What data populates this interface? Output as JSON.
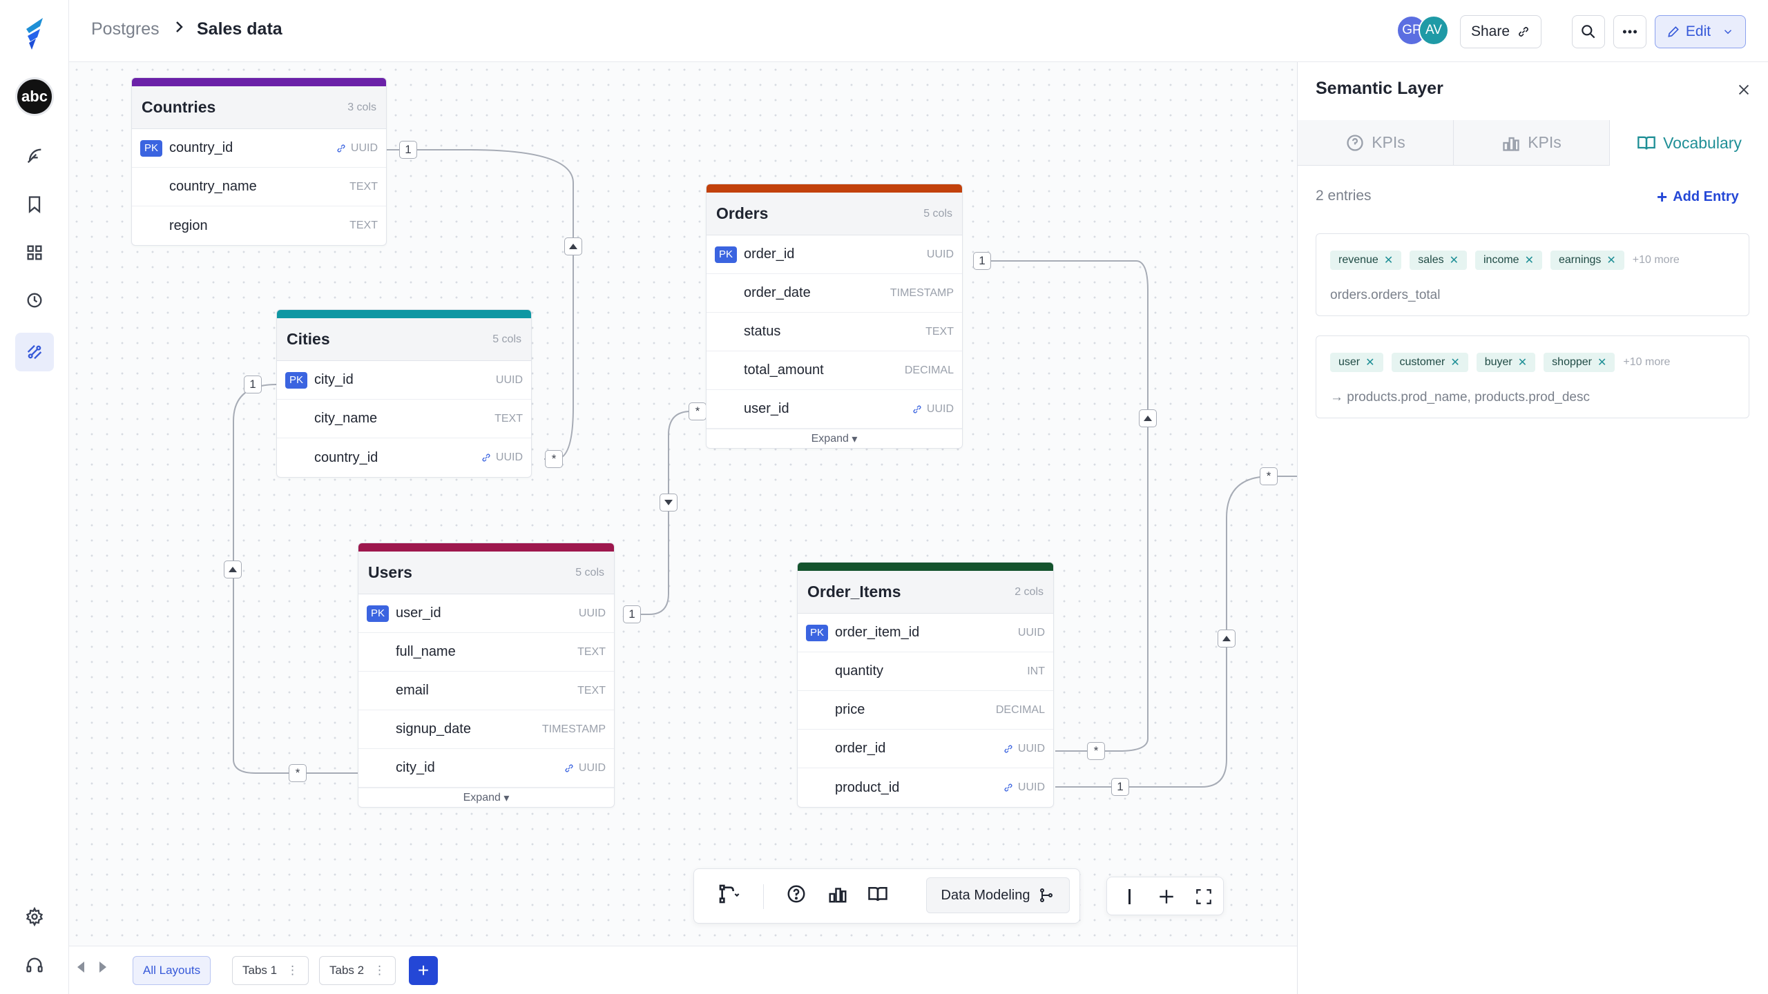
{
  "breadcrumb": {
    "root": "Postgres",
    "current": "Sales data"
  },
  "header": {
    "avatars": [
      "GP",
      "AV"
    ],
    "share_label": "Share",
    "edit_label": "Edit"
  },
  "tables": {
    "countries": {
      "name": "Countries",
      "cols": "3 cols",
      "color": "#6b21a8",
      "rows": [
        {
          "name": "country_id",
          "type": "UUID"
        },
        {
          "name": "country_name",
          "type": "TEXT"
        },
        {
          "name": "region",
          "type": "TEXT"
        }
      ]
    },
    "cities": {
      "name": "Cities",
      "cols": "5 cols",
      "color": "#0f97a3",
      "rows": [
        {
          "name": "city_id",
          "type": "UUID"
        },
        {
          "name": "city_name",
          "type": "TEXT"
        },
        {
          "name": "country_id",
          "type": "UUID"
        }
      ]
    },
    "orders": {
      "name": "Orders",
      "cols": "5 cols",
      "color": "#c2410c",
      "expand": "Expand",
      "rows": [
        {
          "name": "order_id",
          "type": "UUID"
        },
        {
          "name": "order_date",
          "type": "TIMESTAMP"
        },
        {
          "name": "status",
          "type": "TEXT"
        },
        {
          "name": "total_amount",
          "type": "DECIMAL"
        },
        {
          "name": "user_id",
          "type": "UUID"
        }
      ]
    },
    "users": {
      "name": "Users",
      "cols": "5 cols",
      "color": "#9d174d",
      "expand": "Expand",
      "rows": [
        {
          "name": "user_id",
          "type": "UUID"
        },
        {
          "name": "full_name",
          "type": "TEXT"
        },
        {
          "name": "email",
          "type": "TEXT"
        },
        {
          "name": "signup_date",
          "type": "TIMESTAMP"
        },
        {
          "name": "city_id",
          "type": "UUID"
        }
      ]
    },
    "order_items": {
      "name": "Order_Items",
      "cols": "2 cols",
      "color": "#14532d",
      "rows": [
        {
          "name": "order_item_id",
          "type": "UUID"
        },
        {
          "name": "quantity",
          "type": "INT"
        },
        {
          "name": "price",
          "type": "DECIMAL"
        },
        {
          "name": "order_id",
          "type": "UUID"
        },
        {
          "name": "product_id",
          "type": "UUID"
        }
      ]
    }
  },
  "pk_label": "PK",
  "cardinality": {
    "one": "1",
    "many": "*"
  },
  "toolbar": {
    "mode_label": "Data Modeling"
  },
  "footer": {
    "tabs": [
      "All Layouts",
      "Tabs 1",
      "Tabs 2"
    ],
    "add_label": "+"
  },
  "panel": {
    "title": "Semantic Layer",
    "tabs": [
      "KPIs",
      "KPIs",
      "Vocabulary"
    ],
    "entries_count": "2 entries",
    "add_entry": "Add Entry",
    "entries": [
      {
        "chips": [
          "revenue",
          "sales",
          "income",
          "earnings"
        ],
        "more": "+10 more",
        "target": "orders.orders_total"
      },
      {
        "chips": [
          "user",
          "customer",
          "buyer",
          "shopper"
        ],
        "more": "+10 more",
        "target": "→ products.prod_name, products.prod_desc"
      }
    ]
  }
}
